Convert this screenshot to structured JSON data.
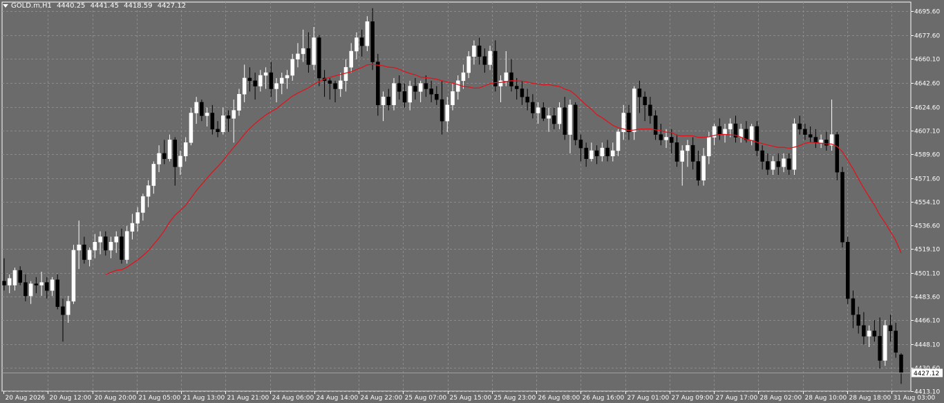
{
  "header": {
    "symbol": "GOLD.m,H1",
    "open": "4440.25",
    "high": "4441.45",
    "low": "4418.59",
    "close": "4427.12"
  },
  "colors": {
    "background": "#6b6b6b",
    "grid": "#8c8c8c",
    "axis_text": "#ffffff",
    "bull": "#ffffff",
    "bear": "#000000",
    "ma": "#e0141c",
    "price_line": "#a0a0a0",
    "highlight": "#ffd700"
  },
  "chart_data": {
    "type": "candlestick",
    "title": "",
    "ylim": [
      4413.1,
      4702.5
    ],
    "y_ticks": [
      "4695.60",
      "4677.60",
      "4660.10",
      "4642.60",
      "4624.60",
      "4607.10",
      "4589.60",
      "4571.60",
      "4554.10",
      "4536.60",
      "4519.10",
      "4501.10",
      "4483.60",
      "4466.10",
      "4448.10",
      "4430.60",
      "4413.10"
    ],
    "x_labels": [
      "20 Aug 2026",
      "20 Aug 12:00",
      "20 Aug 20:00",
      "21 Aug 05:00",
      "21 Aug 13:00",
      "21 Aug 21:00",
      "24 Aug 06:00",
      "24 Aug 14:00",
      "24 Aug 22:00",
      "25 Aug 07:00",
      "25 Aug 15:00",
      "25 Aug 23:00",
      "26 Aug 08:00",
      "26 Aug 16:00",
      "27 Aug 01:00",
      "27 Aug 09:00",
      "27 Aug 17:00",
      "28 Aug 02:00",
      "28 Aug 10:00",
      "28 Aug 18:00",
      "31 Aug 03:00"
    ],
    "current_price": "4427.12",
    "candles": [
      {
        "o": 4495,
        "h": 4512,
        "l": 4488,
        "c": 4492
      },
      {
        "o": 4492,
        "h": 4500,
        "l": 4486,
        "c": 4497
      },
      {
        "o": 4492,
        "h": 4505,
        "l": 4488,
        "c": 4503
      },
      {
        "o": 4503,
        "h": 4506,
        "l": 4492,
        "c": 4494
      },
      {
        "o": 4494,
        "h": 4500,
        "l": 4480,
        "c": 4484
      },
      {
        "o": 4484,
        "h": 4495,
        "l": 4478,
        "c": 4493
      },
      {
        "o": 4493,
        "h": 4498,
        "l": 4486,
        "c": 4492
      },
      {
        "o": 4492,
        "h": 4502,
        "l": 4484,
        "c": 4494
      },
      {
        "o": 4494,
        "h": 4498,
        "l": 4482,
        "c": 4488
      },
      {
        "o": 4488,
        "h": 4498,
        "l": 4484,
        "c": 4496
      },
      {
        "o": 4496,
        "h": 4500,
        "l": 4474,
        "c": 4476
      },
      {
        "o": 4476,
        "h": 4482,
        "l": 4450,
        "c": 4470
      },
      {
        "o": 4470,
        "h": 4484,
        "l": 4464,
        "c": 4480
      },
      {
        "o": 4480,
        "h": 4522,
        "l": 4478,
        "c": 4518
      },
      {
        "o": 4518,
        "h": 4540,
        "l": 4504,
        "c": 4522
      },
      {
        "o": 4522,
        "h": 4528,
        "l": 4508,
        "c": 4511
      },
      {
        "o": 4511,
        "h": 4520,
        "l": 4506,
        "c": 4518
      },
      {
        "o": 4518,
        "h": 4530,
        "l": 4512,
        "c": 4524
      },
      {
        "o": 4524,
        "h": 4532,
        "l": 4515,
        "c": 4528
      },
      {
        "o": 4528,
        "h": 4532,
        "l": 4514,
        "c": 4518
      },
      {
        "o": 4518,
        "h": 4528,
        "l": 4512,
        "c": 4524
      },
      {
        "o": 4524,
        "h": 4532,
        "l": 4516,
        "c": 4528
      },
      {
        "o": 4528,
        "h": 4534,
        "l": 4508,
        "c": 4511
      },
      {
        "o": 4511,
        "h": 4536,
        "l": 4508,
        "c": 4532
      },
      {
        "o": 4532,
        "h": 4545,
        "l": 4526,
        "c": 4538
      },
      {
        "o": 4538,
        "h": 4550,
        "l": 4532,
        "c": 4546
      },
      {
        "o": 4546,
        "h": 4560,
        "l": 4540,
        "c": 4558
      },
      {
        "o": 4558,
        "h": 4570,
        "l": 4550,
        "c": 4566
      },
      {
        "o": 4566,
        "h": 4584,
        "l": 4560,
        "c": 4582
      },
      {
        "o": 4582,
        "h": 4596,
        "l": 4576,
        "c": 4590
      },
      {
        "o": 4590,
        "h": 4600,
        "l": 4582,
        "c": 4586
      },
      {
        "o": 4586,
        "h": 4604,
        "l": 4584,
        "c": 4600
      },
      {
        "o": 4600,
        "h": 4602,
        "l": 4566,
        "c": 4580
      },
      {
        "o": 4580,
        "h": 4592,
        "l": 4574,
        "c": 4588
      },
      {
        "o": 4588,
        "h": 4602,
        "l": 4584,
        "c": 4598
      },
      {
        "o": 4598,
        "h": 4624,
        "l": 4596,
        "c": 4620
      },
      {
        "o": 4620,
        "h": 4632,
        "l": 4612,
        "c": 4628
      },
      {
        "o": 4628,
        "h": 4630,
        "l": 4614,
        "c": 4618
      },
      {
        "o": 4618,
        "h": 4624,
        "l": 4610,
        "c": 4620
      },
      {
        "o": 4620,
        "h": 4626,
        "l": 4604,
        "c": 4608
      },
      {
        "o": 4608,
        "h": 4614,
        "l": 4602,
        "c": 4606
      },
      {
        "o": 4606,
        "h": 4624,
        "l": 4604,
        "c": 4618
      },
      {
        "o": 4618,
        "h": 4622,
        "l": 4606,
        "c": 4616
      },
      {
        "o": 4616,
        "h": 4630,
        "l": 4598,
        "c": 4622
      },
      {
        "o": 4622,
        "h": 4638,
        "l": 4618,
        "c": 4634
      },
      {
        "o": 4634,
        "h": 4656,
        "l": 4628,
        "c": 4646
      },
      {
        "o": 4646,
        "h": 4654,
        "l": 4636,
        "c": 4644
      },
      {
        "o": 4644,
        "h": 4650,
        "l": 4630,
        "c": 4640
      },
      {
        "o": 4640,
        "h": 4652,
        "l": 4636,
        "c": 4648
      },
      {
        "o": 4648,
        "h": 4654,
        "l": 4638,
        "c": 4650
      },
      {
        "o": 4650,
        "h": 4658,
        "l": 4632,
        "c": 4638
      },
      {
        "o": 4638,
        "h": 4646,
        "l": 4628,
        "c": 4642
      },
      {
        "o": 4642,
        "h": 4650,
        "l": 4634,
        "c": 4646
      },
      {
        "o": 4646,
        "h": 4652,
        "l": 4638,
        "c": 4648
      },
      {
        "o": 4648,
        "h": 4664,
        "l": 4644,
        "c": 4660
      },
      {
        "o": 4660,
        "h": 4672,
        "l": 4654,
        "c": 4664
      },
      {
        "o": 4664,
        "h": 4682,
        "l": 4658,
        "c": 4668
      },
      {
        "o": 4668,
        "h": 4680,
        "l": 4650,
        "c": 4656
      },
      {
        "o": 4656,
        "h": 4684,
        "l": 4652,
        "c": 4676
      },
      {
        "o": 4676,
        "h": 4678,
        "l": 4640,
        "c": 4646
      },
      {
        "o": 4646,
        "h": 4652,
        "l": 4632,
        "c": 4644
      },
      {
        "o": 4644,
        "h": 4646,
        "l": 4630,
        "c": 4642
      },
      {
        "o": 4642,
        "h": 4644,
        "l": 4628,
        "c": 4638
      },
      {
        "o": 4638,
        "h": 4650,
        "l": 4632,
        "c": 4644
      },
      {
        "o": 4644,
        "h": 4660,
        "l": 4636,
        "c": 4654
      },
      {
        "o": 4654,
        "h": 4672,
        "l": 4650,
        "c": 4666
      },
      {
        "o": 4666,
        "h": 4680,
        "l": 4660,
        "c": 4676
      },
      {
        "o": 4676,
        "h": 4682,
        "l": 4662,
        "c": 4670
      },
      {
        "o": 4670,
        "h": 4692,
        "l": 4666,
        "c": 4688
      },
      {
        "o": 4688,
        "h": 4698,
        "l": 4652,
        "c": 4658
      },
      {
        "o": 4658,
        "h": 4664,
        "l": 4618,
        "c": 4626
      },
      {
        "o": 4626,
        "h": 4636,
        "l": 4614,
        "c": 4632
      },
      {
        "o": 4632,
        "h": 4638,
        "l": 4622,
        "c": 4626
      },
      {
        "o": 4626,
        "h": 4646,
        "l": 4622,
        "c": 4642
      },
      {
        "o": 4642,
        "h": 4648,
        "l": 4630,
        "c": 4636
      },
      {
        "o": 4636,
        "h": 4642,
        "l": 4624,
        "c": 4628
      },
      {
        "o": 4628,
        "h": 4644,
        "l": 4622,
        "c": 4640
      },
      {
        "o": 4640,
        "h": 4646,
        "l": 4630,
        "c": 4636
      },
      {
        "o": 4636,
        "h": 4644,
        "l": 4628,
        "c": 4642
      },
      {
        "o": 4642,
        "h": 4648,
        "l": 4632,
        "c": 4638
      },
      {
        "o": 4638,
        "h": 4644,
        "l": 4628,
        "c": 4634
      },
      {
        "o": 4634,
        "h": 4640,
        "l": 4626,
        "c": 4630
      },
      {
        "o": 4630,
        "h": 4644,
        "l": 4604,
        "c": 4614
      },
      {
        "o": 4614,
        "h": 4632,
        "l": 4606,
        "c": 4626
      },
      {
        "o": 4626,
        "h": 4642,
        "l": 4622,
        "c": 4636
      },
      {
        "o": 4636,
        "h": 4648,
        "l": 4630,
        "c": 4644
      },
      {
        "o": 4644,
        "h": 4656,
        "l": 4638,
        "c": 4650
      },
      {
        "o": 4650,
        "h": 4666,
        "l": 4646,
        "c": 4662
      },
      {
        "o": 4662,
        "h": 4674,
        "l": 4656,
        "c": 4670
      },
      {
        "o": 4670,
        "h": 4676,
        "l": 4656,
        "c": 4662
      },
      {
        "o": 4662,
        "h": 4668,
        "l": 4650,
        "c": 4656
      },
      {
        "o": 4656,
        "h": 4670,
        "l": 4652,
        "c": 4666
      },
      {
        "o": 4666,
        "h": 4674,
        "l": 4636,
        "c": 4640
      },
      {
        "o": 4640,
        "h": 4648,
        "l": 4628,
        "c": 4644
      },
      {
        "o": 4644,
        "h": 4666,
        "l": 4640,
        "c": 4650
      },
      {
        "o": 4650,
        "h": 4660,
        "l": 4636,
        "c": 4640
      },
      {
        "o": 4640,
        "h": 4646,
        "l": 4630,
        "c": 4638
      },
      {
        "o": 4638,
        "h": 4644,
        "l": 4626,
        "c": 4632
      },
      {
        "o": 4632,
        "h": 4638,
        "l": 4622,
        "c": 4628
      },
      {
        "o": 4628,
        "h": 4634,
        "l": 4616,
        "c": 4620
      },
      {
        "o": 4620,
        "h": 4628,
        "l": 4612,
        "c": 4624
      },
      {
        "o": 4624,
        "h": 4628,
        "l": 4614,
        "c": 4616
      },
      {
        "o": 4616,
        "h": 4624,
        "l": 4606,
        "c": 4618
      },
      {
        "o": 4618,
        "h": 4624,
        "l": 4608,
        "c": 4612
      },
      {
        "o": 4612,
        "h": 4628,
        "l": 4608,
        "c": 4624
      },
      {
        "o": 4624,
        "h": 4632,
        "l": 4600,
        "c": 4604
      },
      {
        "o": 4604,
        "h": 4630,
        "l": 4590,
        "c": 4626
      },
      {
        "o": 4626,
        "h": 4628,
        "l": 4596,
        "c": 4600
      },
      {
        "o": 4600,
        "h": 4604,
        "l": 4584,
        "c": 4594
      },
      {
        "o": 4594,
        "h": 4598,
        "l": 4580,
        "c": 4586
      },
      {
        "o": 4586,
        "h": 4598,
        "l": 4584,
        "c": 4592
      },
      {
        "o": 4592,
        "h": 4596,
        "l": 4582,
        "c": 4588
      },
      {
        "o": 4588,
        "h": 4598,
        "l": 4584,
        "c": 4594
      },
      {
        "o": 4594,
        "h": 4600,
        "l": 4584,
        "c": 4588
      },
      {
        "o": 4588,
        "h": 4598,
        "l": 4584,
        "c": 4592
      },
      {
        "o": 4592,
        "h": 4608,
        "l": 4588,
        "c": 4606
      },
      {
        "o": 4606,
        "h": 4626,
        "l": 4600,
        "c": 4620
      },
      {
        "o": 4620,
        "h": 4626,
        "l": 4600,
        "c": 4606
      },
      {
        "o": 4606,
        "h": 4640,
        "l": 4600,
        "c": 4638
      },
      {
        "o": 4638,
        "h": 4644,
        "l": 4620,
        "c": 4632
      },
      {
        "o": 4632,
        "h": 4636,
        "l": 4614,
        "c": 4626
      },
      {
        "o": 4626,
        "h": 4632,
        "l": 4612,
        "c": 4618
      },
      {
        "o": 4618,
        "h": 4622,
        "l": 4600,
        "c": 4604
      },
      {
        "o": 4604,
        "h": 4612,
        "l": 4596,
        "c": 4600
      },
      {
        "o": 4600,
        "h": 4608,
        "l": 4594,
        "c": 4602
      },
      {
        "o": 4602,
        "h": 4608,
        "l": 4590,
        "c": 4598
      },
      {
        "o": 4598,
        "h": 4604,
        "l": 4580,
        "c": 4584
      },
      {
        "o": 4584,
        "h": 4596,
        "l": 4566,
        "c": 4592
      },
      {
        "o": 4592,
        "h": 4600,
        "l": 4580,
        "c": 4596
      },
      {
        "o": 4596,
        "h": 4602,
        "l": 4578,
        "c": 4584
      },
      {
        "o": 4584,
        "h": 4592,
        "l": 4566,
        "c": 4570
      },
      {
        "o": 4570,
        "h": 4594,
        "l": 4566,
        "c": 4588
      },
      {
        "o": 4588,
        "h": 4606,
        "l": 4582,
        "c": 4602
      },
      {
        "o": 4602,
        "h": 4612,
        "l": 4596,
        "c": 4610
      },
      {
        "o": 4610,
        "h": 4616,
        "l": 4600,
        "c": 4604
      },
      {
        "o": 4604,
        "h": 4612,
        "l": 4598,
        "c": 4608
      },
      {
        "o": 4608,
        "h": 4616,
        "l": 4602,
        "c": 4612
      },
      {
        "o": 4612,
        "h": 4618,
        "l": 4598,
        "c": 4602
      },
      {
        "o": 4602,
        "h": 4612,
        "l": 4598,
        "c": 4608
      },
      {
        "o": 4608,
        "h": 4614,
        "l": 4598,
        "c": 4600
      },
      {
        "o": 4600,
        "h": 4612,
        "l": 4596,
        "c": 4610
      },
      {
        "o": 4610,
        "h": 4614,
        "l": 4588,
        "c": 4592
      },
      {
        "o": 4592,
        "h": 4596,
        "l": 4578,
        "c": 4584
      },
      {
        "o": 4584,
        "h": 4590,
        "l": 4574,
        "c": 4578
      },
      {
        "o": 4578,
        "h": 4588,
        "l": 4574,
        "c": 4584
      },
      {
        "o": 4584,
        "h": 4590,
        "l": 4574,
        "c": 4580
      },
      {
        "o": 4580,
        "h": 4590,
        "l": 4576,
        "c": 4586
      },
      {
        "o": 4586,
        "h": 4590,
        "l": 4574,
        "c": 4578
      },
      {
        "o": 4578,
        "h": 4616,
        "l": 4574,
        "c": 4612
      },
      {
        "o": 4612,
        "h": 4618,
        "l": 4604,
        "c": 4608
      },
      {
        "o": 4608,
        "h": 4612,
        "l": 4600,
        "c": 4604
      },
      {
        "o": 4604,
        "h": 4610,
        "l": 4598,
        "c": 4602
      },
      {
        "o": 4602,
        "h": 4608,
        "l": 4594,
        "c": 4598
      },
      {
        "o": 4598,
        "h": 4604,
        "l": 4594,
        "c": 4600
      },
      {
        "o": 4600,
        "h": 4606,
        "l": 4592,
        "c": 4596
      },
      {
        "o": 4596,
        "h": 4630,
        "l": 4592,
        "c": 4604
      },
      {
        "o": 4604,
        "h": 4606,
        "l": 4570,
        "c": 4576
      },
      {
        "o": 4576,
        "h": 4580,
        "l": 4520,
        "c": 4524
      },
      {
        "o": 4524,
        "h": 4528,
        "l": 4478,
        "c": 4482
      },
      {
        "o": 4482,
        "h": 4488,
        "l": 4460,
        "c": 4470
      },
      {
        "o": 4470,
        "h": 4476,
        "l": 4456,
        "c": 4462
      },
      {
        "o": 4462,
        "h": 4472,
        "l": 4448,
        "c": 4454
      },
      {
        "o": 4454,
        "h": 4462,
        "l": 4446,
        "c": 4458
      },
      {
        "o": 4458,
        "h": 4466,
        "l": 4450,
        "c": 4454
      },
      {
        "o": 4454,
        "h": 4468,
        "l": 4430,
        "c": 4436
      },
      {
        "o": 4436,
        "h": 4466,
        "l": 4432,
        "c": 4462
      },
      {
        "o": 4462,
        "h": 4470,
        "l": 4450,
        "c": 4458
      },
      {
        "o": 4458,
        "h": 4464,
        "l": 4438,
        "c": 4442
      },
      {
        "o": 4440.25,
        "h": 4441.45,
        "l": 4418.59,
        "c": 4427.12
      }
    ]
  }
}
